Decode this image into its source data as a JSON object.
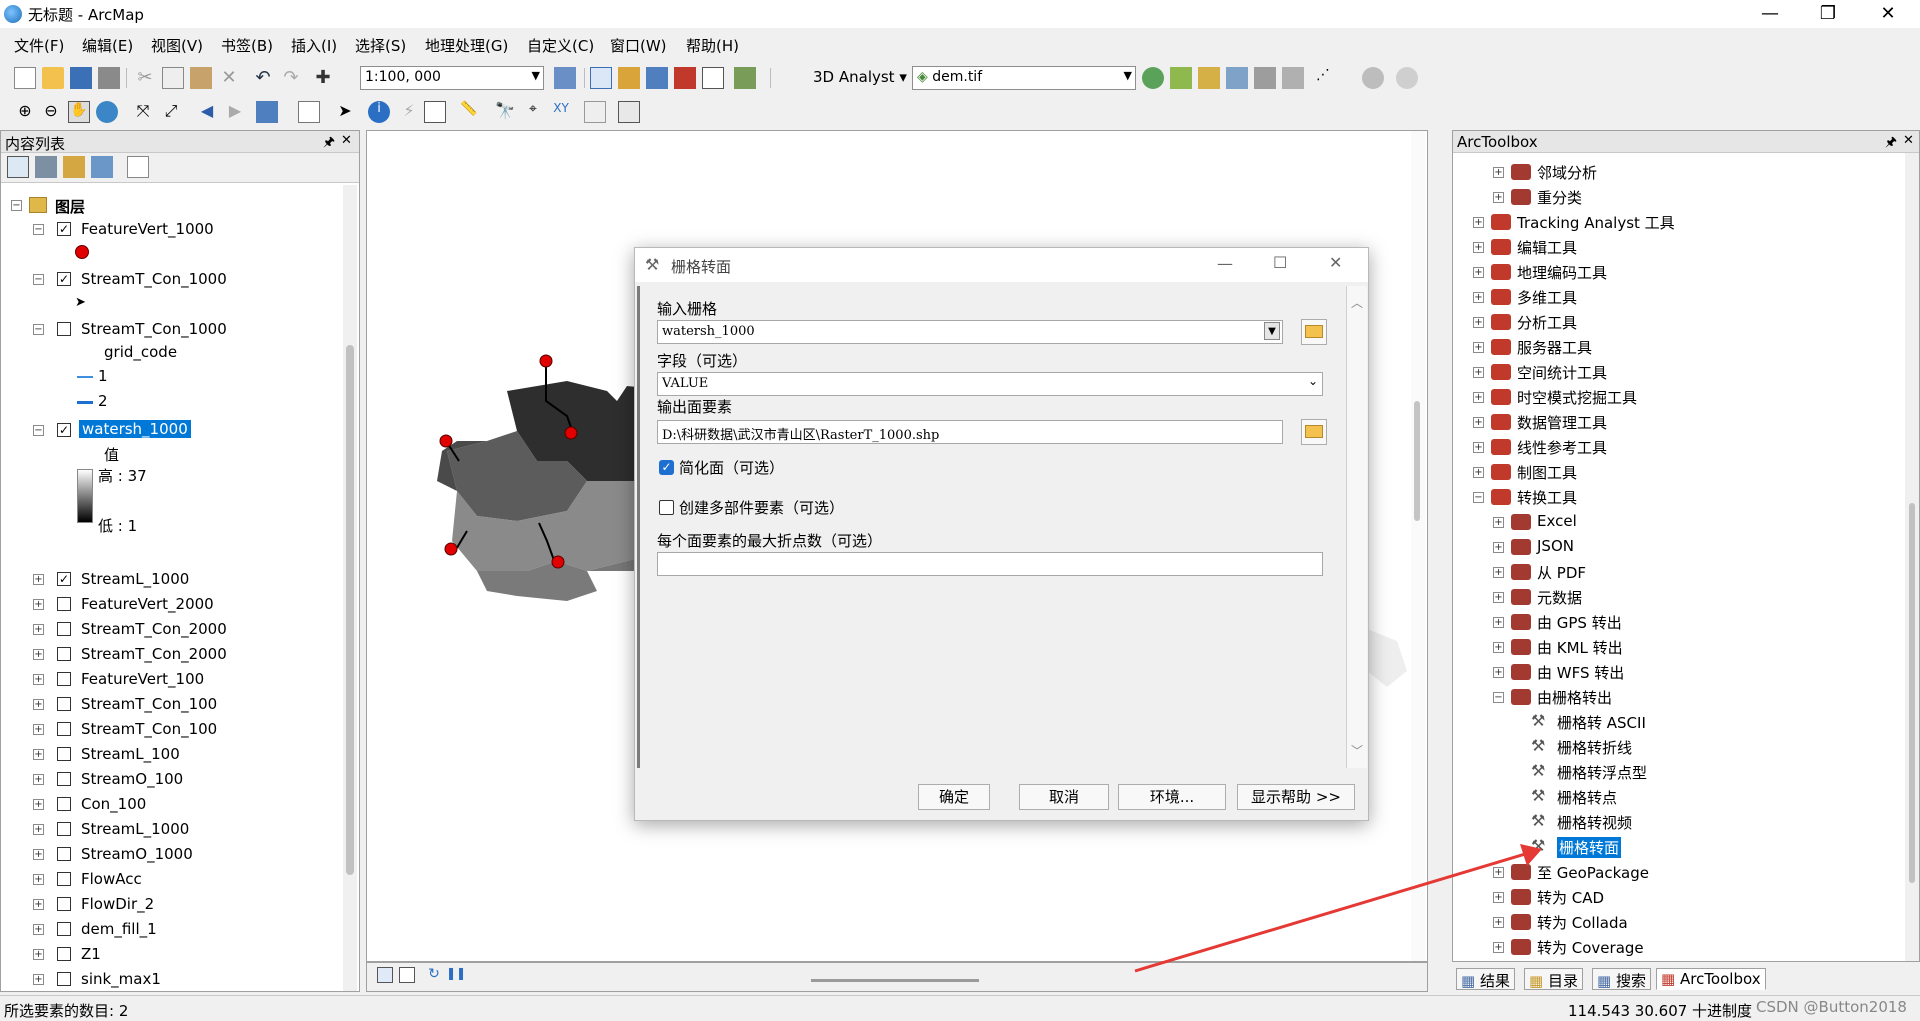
{
  "window": {
    "title": "无标题 - ArcMap",
    "min": "—",
    "restore": "❐",
    "close": "✕"
  },
  "menu": [
    "文件(F)",
    "编辑(E)",
    "视图(V)",
    "书签(B)",
    "插入(I)",
    "选择(S)",
    "地理处理(G)",
    "自定义(C)",
    "窗口(W)",
    "帮助(H)"
  ],
  "toolbar": {
    "scale": "1:100, 000",
    "analyst_label": "3D Analyst",
    "raster_layer": "dem.tif"
  },
  "toc": {
    "title": "内容列表",
    "pin": "🖈",
    "close": "✕",
    "group_label": "图层",
    "layers": [
      {
        "name": "FeatureVert_1000",
        "checked": true,
        "expanded": true
      },
      {
        "name": "StreamT_Con_1000",
        "checked": true,
        "expanded": true
      },
      {
        "name": "StreamT_Con_1000",
        "checked": false,
        "expanded": true
      },
      {
        "name": "watersh_1000",
        "checked": true,
        "expanded": true,
        "selected": true
      },
      {
        "name": "StreamL_1000",
        "checked": true,
        "expanded": false
      },
      {
        "name": "FeatureVert_2000",
        "checked": false,
        "expanded": false
      },
      {
        "name": "StreamT_Con_2000",
        "checked": false,
        "expanded": false
      },
      {
        "name": "StreamT_Con_2000",
        "checked": false,
        "expanded": false
      },
      {
        "name": "FeatureVert_100",
        "checked": false,
        "expanded": false
      },
      {
        "name": "StreamT_Con_100",
        "checked": false,
        "expanded": false
      },
      {
        "name": "StreamT_Con_100",
        "checked": false,
        "expanded": false
      },
      {
        "name": "StreamL_100",
        "checked": false,
        "expanded": false
      },
      {
        "name": "StreamO_100",
        "checked": false,
        "expanded": false
      },
      {
        "name": "Con_100",
        "checked": false,
        "expanded": false
      },
      {
        "name": "StreamL_1000",
        "checked": false,
        "expanded": false
      },
      {
        "name": "StreamO_1000",
        "checked": false,
        "expanded": false
      },
      {
        "name": "FlowAcc",
        "checked": false,
        "expanded": false
      },
      {
        "name": "FlowDir_2",
        "checked": false,
        "expanded": false
      },
      {
        "name": "dem_fill_1",
        "checked": false,
        "expanded": false
      },
      {
        "name": "Z1",
        "checked": false,
        "expanded": false
      },
      {
        "name": "sink_max1",
        "checked": false,
        "expanded": false
      }
    ],
    "legend_field": "grid_code",
    "legend_v1": "1",
    "legend_v2": "2",
    "legend_value": "值",
    "legend_high": "高 : 37",
    "legend_low": "低 : 1"
  },
  "dialog": {
    "title": "栅格转面",
    "input_raster_label": "输入栅格",
    "input_raster_value": "watersh_1000",
    "field_label": "字段（可选）",
    "field_value": "VALUE",
    "output_label": "输出面要素",
    "output_value": "D:\\科研数据\\武汉市青山区\\RasterT_1000.shp",
    "simplify_label": "简化面（可选）",
    "simplify_checked": true,
    "multipart_label": "创建多部件要素（可选）",
    "multipart_checked": false,
    "max_vertices_label": "每个面要素的最大折点数（可选）",
    "max_vertices_value": "",
    "ok": "确定",
    "cancel": "取消",
    "env": "环境...",
    "help": "显示帮助 >>"
  },
  "toolbox": {
    "title": "ArcToolbox",
    "items": [
      {
        "label": "邻域分析",
        "level": 1,
        "type": "box"
      },
      {
        "label": "重分类",
        "level": 1,
        "type": "box"
      },
      {
        "label": "Tracking Analyst 工具",
        "level": 0,
        "type": "box"
      },
      {
        "label": "编辑工具",
        "level": 0,
        "type": "box"
      },
      {
        "label": "地理编码工具",
        "level": 0,
        "type": "box"
      },
      {
        "label": "多维工具",
        "level": 0,
        "type": "box"
      },
      {
        "label": "分析工具",
        "level": 0,
        "type": "box"
      },
      {
        "label": "服务器工具",
        "level": 0,
        "type": "box"
      },
      {
        "label": "空间统计工具",
        "level": 0,
        "type": "box"
      },
      {
        "label": "时空模式挖掘工具",
        "level": 0,
        "type": "box"
      },
      {
        "label": "数据管理工具",
        "level": 0,
        "type": "box"
      },
      {
        "label": "线性参考工具",
        "level": 0,
        "type": "box"
      },
      {
        "label": "制图工具",
        "level": 0,
        "type": "box"
      },
      {
        "label": "转换工具",
        "level": 0,
        "type": "box",
        "open": true
      },
      {
        "label": "Excel",
        "level": 1,
        "type": "box"
      },
      {
        "label": "JSON",
        "level": 1,
        "type": "box"
      },
      {
        "label": "从 PDF",
        "level": 1,
        "type": "box"
      },
      {
        "label": "元数据",
        "level": 1,
        "type": "box"
      },
      {
        "label": "由 GPS 转出",
        "level": 1,
        "type": "box"
      },
      {
        "label": "由 KML 转出",
        "level": 1,
        "type": "box"
      },
      {
        "label": "由 WFS 转出",
        "level": 1,
        "type": "box"
      },
      {
        "label": "由栅格转出",
        "level": 1,
        "type": "box",
        "open": true
      },
      {
        "label": "栅格转 ASCII",
        "level": 2,
        "type": "tool"
      },
      {
        "label": "栅格转折线",
        "level": 2,
        "type": "tool"
      },
      {
        "label": "栅格转浮点型",
        "level": 2,
        "type": "tool"
      },
      {
        "label": "栅格转点",
        "level": 2,
        "type": "tool"
      },
      {
        "label": "栅格转视频",
        "level": 2,
        "type": "tool"
      },
      {
        "label": "栅格转面",
        "level": 2,
        "type": "tool",
        "selected": true
      },
      {
        "label": "至 GeoPackage",
        "level": 1,
        "type": "box"
      },
      {
        "label": "转为 CAD",
        "level": 1,
        "type": "box"
      },
      {
        "label": "转为 Collada",
        "level": 1,
        "type": "box"
      },
      {
        "label": "转为 Coverage",
        "level": 1,
        "type": "box"
      }
    ],
    "tabs": [
      "结果",
      "目录",
      "搜索",
      "ArcToolbox"
    ]
  },
  "status": {
    "selected_count": "所选要素的数目: 2",
    "coords": "114.543  30.607 十进制度",
    "watermark": "CSDN @Button2018"
  },
  "colors": {
    "selection": "#0078d7",
    "arrow": "#e53935",
    "vertex": "#e00000"
  }
}
